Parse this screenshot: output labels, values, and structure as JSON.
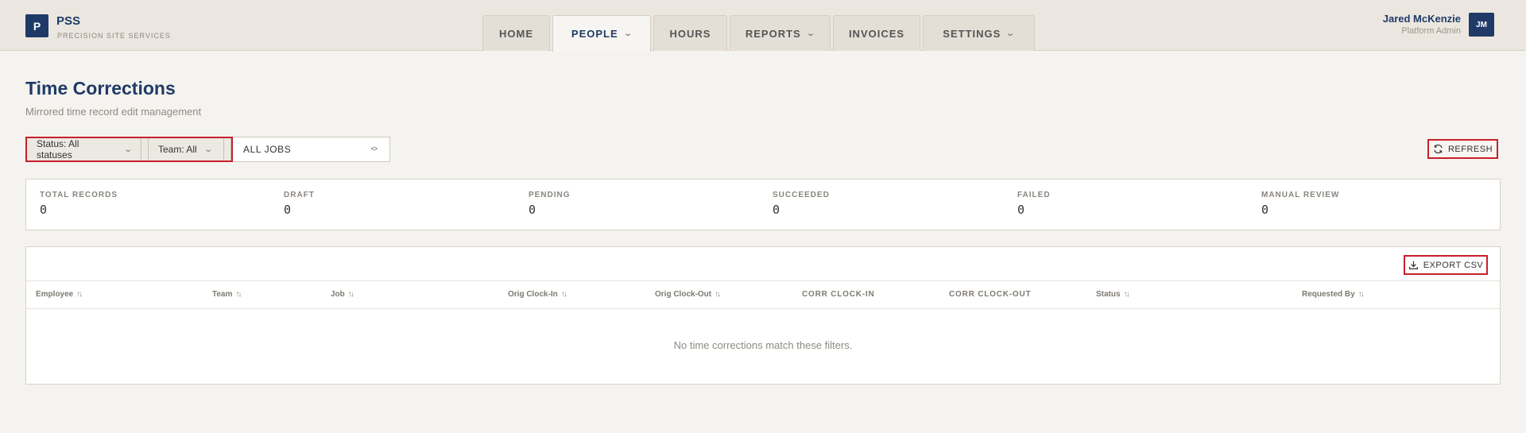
{
  "brand": {
    "logo_letter": "P",
    "name": "PSS",
    "subtitle": "PRECISION SITE SERVICES"
  },
  "nav": {
    "tabs": [
      {
        "label": "HOME",
        "dropdown": false,
        "active": false
      },
      {
        "label": "PEOPLE",
        "dropdown": true,
        "active": true
      },
      {
        "label": "HOURS",
        "dropdown": false,
        "active": false
      },
      {
        "label": "REPORTS",
        "dropdown": true,
        "active": false
      },
      {
        "label": "INVOICES",
        "dropdown": false,
        "active": false
      },
      {
        "label": "SETTINGS",
        "dropdown": true,
        "active": false
      }
    ]
  },
  "user": {
    "name": "Jared McKenzie",
    "role": "Platform Admin",
    "initials": "JM"
  },
  "page": {
    "title": "Time Corrections",
    "subtitle": "Mirrored time record edit management"
  },
  "filters": {
    "status_label": "Status: All statuses",
    "team_label": "Team: All",
    "job_value": "ALL JOBS"
  },
  "actions": {
    "refresh_label": "REFRESH",
    "export_label": "EXPORT CSV"
  },
  "stats": [
    {
      "label": "TOTAL RECORDS",
      "value": "0"
    },
    {
      "label": "DRAFT",
      "value": "0"
    },
    {
      "label": "PENDING",
      "value": "0"
    },
    {
      "label": "SUCCEEDED",
      "value": "0"
    },
    {
      "label": "FAILED",
      "value": "0"
    },
    {
      "label": "MANUAL REVIEW",
      "value": "0"
    }
  ],
  "table": {
    "columns": [
      {
        "label": "Employee",
        "sortable": true
      },
      {
        "label": "Team",
        "sortable": true
      },
      {
        "label": "Job",
        "sortable": true
      },
      {
        "label": "Orig Clock-In",
        "sortable": true
      },
      {
        "label": "Orig Clock-Out",
        "sortable": true
      },
      {
        "label": "CORR CLOCK-IN",
        "sortable": false
      },
      {
        "label": "CORR CLOCK-OUT",
        "sortable": false
      },
      {
        "label": "Status",
        "sortable": true
      },
      {
        "label": "Requested By",
        "sortable": true
      }
    ],
    "empty_message": "No time corrections match these filters."
  },
  "colors": {
    "brand": "#1f3a66",
    "highlight": "#c6202a",
    "background": "#f5f3ef"
  }
}
